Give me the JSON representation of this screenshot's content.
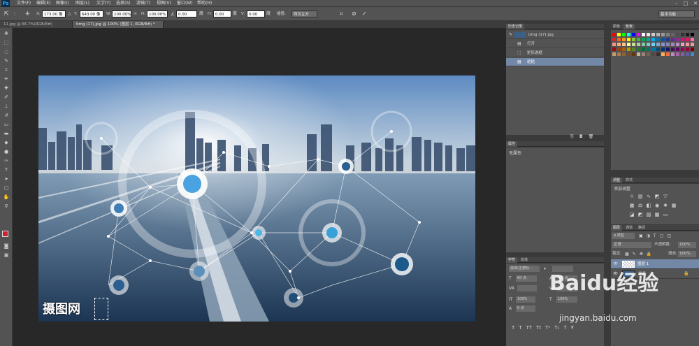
{
  "app": {
    "logo": "Ps",
    "menu": [
      "文件(F)",
      "编辑(E)",
      "图像(I)",
      "图层(L)",
      "文字(Y)",
      "选择(S)",
      "滤镜(T)",
      "视图(V)",
      "窗口(W)",
      "帮助(H)"
    ],
    "workspace": "基本功能"
  },
  "options": {
    "x_label": "X:",
    "x_value": "173.00 像",
    "y_label": "Y:",
    "y_value": "643.00 像",
    "w_label": "W:",
    "w_value": "100.00%",
    "h_label": "H:",
    "h_value": "100.00%",
    "angle_value": "0.00",
    "hskew_label": "H:",
    "hskew_value": "0.00",
    "vskew_label": "V:",
    "vskew_value": "0.00",
    "interp_label": "插值:",
    "interp_value": "两次立方"
  },
  "tabs": [
    {
      "label": "11.jpg @ 66.7%(RGB/8#)",
      "active": false
    },
    {
      "label": "timg (17).jpg @ 100% (图层 1, RGB/8#) *",
      "active": true
    }
  ],
  "canvas": {
    "watermark": "摄图网"
  },
  "history": {
    "tab": "历史记录",
    "snapshot": "timg (17).jpg",
    "items": [
      "打开",
      "矩形选框",
      "粘贴"
    ],
    "selected_index": 2
  },
  "swatches": {
    "tabs": [
      "颜色",
      "色板"
    ]
  },
  "properties": {
    "tab": "属性",
    "empty_text": "无属性"
  },
  "adjustments": {
    "tabs": [
      "调整",
      "样式"
    ],
    "add_label": "添加调整"
  },
  "layers": {
    "tabs": [
      "图层",
      "通道",
      "路径"
    ],
    "filter": "ρ 类型",
    "blend_mode": "正常",
    "opacity_label": "不透明度:",
    "opacity_value": "100%",
    "lock_label": "锁定:",
    "fill_label": "填充:",
    "fill_value": "100%",
    "items": [
      {
        "name": "图层 1",
        "selected": true
      },
      {
        "name": "背景",
        "selected": false
      }
    ]
  },
  "character": {
    "tabs": [
      "字符",
      "段落"
    ],
    "font_family": "黑体(正德标...",
    "font_size": "60 点",
    "leading": "4.5 点",
    "tracking": "0",
    "scale_v": "100%",
    "scale_h": "100%",
    "baseline": "0 点"
  },
  "watermark": {
    "brand": "Baidu经验",
    "url": "jingyan.baidu.com"
  },
  "colors": {
    "accent": "#31a8ff",
    "selection": "#7288a6",
    "foreground": "#cc1f2f",
    "background": "#ffffff"
  }
}
